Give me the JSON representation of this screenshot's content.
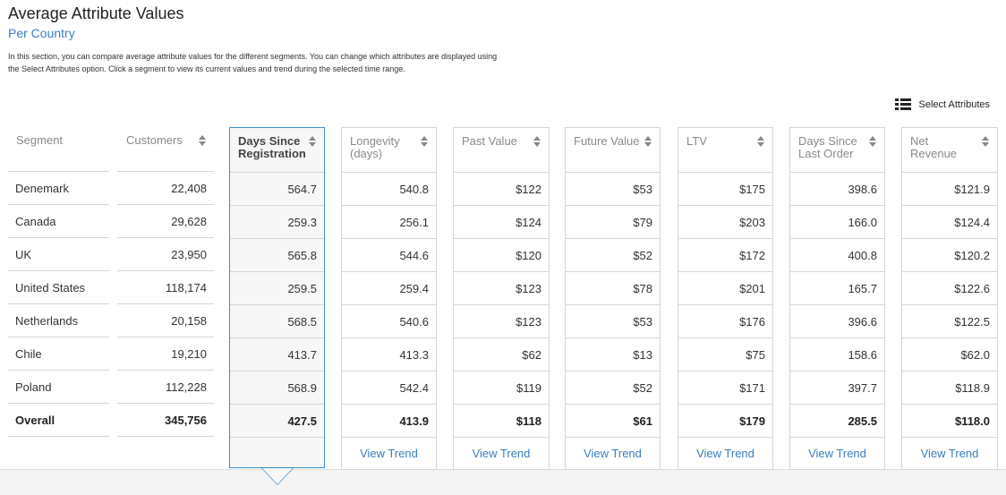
{
  "title": "Average Attribute Values",
  "subtitle": "Per Country",
  "description": "In this section, you can compare average attribute values for the different segments. You can change which attributes are displayed using the Select Attributes option. Click a segment to view its current values and trend during the selected time range.",
  "select_attributes": {
    "label": "Select Attributes",
    "icon": "list-icon"
  },
  "view_trend_label": "View Trend",
  "columns": {
    "segment": {
      "label": "Segment"
    },
    "customers": {
      "label": "Customers"
    },
    "days_since_registration": {
      "label_line1": "Days Since",
      "label_line2": "Registration"
    },
    "longevity": {
      "label_line1": "Longevity",
      "label_line2": "(days)"
    },
    "past_value": {
      "label": "Past Value"
    },
    "future_value": {
      "label": "Future Value"
    },
    "ltv": {
      "label": "LTV"
    },
    "days_since_last_order": {
      "label_line1": "Days Since",
      "label_line2": "Last Order"
    },
    "net_revenue": {
      "label_line1": "Net",
      "label_line2": "Revenue"
    }
  },
  "rows": [
    {
      "segment": "Denemark",
      "customers": "22,408",
      "dsr": "564.7",
      "longevity": "540.8",
      "past": "$122",
      "future": "$53",
      "ltv": "$175",
      "dslo": "398.6",
      "net": "$121.9"
    },
    {
      "segment": "Canada",
      "customers": "29,628",
      "dsr": "259.3",
      "longevity": "256.1",
      "past": "$124",
      "future": "$79",
      "ltv": "$203",
      "dslo": "166.0",
      "net": "$124.4"
    },
    {
      "segment": "UK",
      "customers": "23,950",
      "dsr": "565.8",
      "longevity": "544.6",
      "past": "$120",
      "future": "$52",
      "ltv": "$172",
      "dslo": "400.8",
      "net": "$120.2"
    },
    {
      "segment": "United States",
      "customers": "118,174",
      "dsr": "259.5",
      "longevity": "259.4",
      "past": "$123",
      "future": "$78",
      "ltv": "$201",
      "dslo": "165.7",
      "net": "$122.6"
    },
    {
      "segment": "Netherlands",
      "customers": "20,158",
      "dsr": "568.5",
      "longevity": "540.6",
      "past": "$123",
      "future": "$53",
      "ltv": "$176",
      "dslo": "396.6",
      "net": "$122.5"
    },
    {
      "segment": "Chile",
      "customers": "19,210",
      "dsr": "413.7",
      "longevity": "413.3",
      "past": "$62",
      "future": "$13",
      "ltv": "$75",
      "dslo": "158.6",
      "net": "$62.0"
    },
    {
      "segment": "Poland",
      "customers": "112,228",
      "dsr": "568.9",
      "longevity": "542.4",
      "past": "$119",
      "future": "$52",
      "ltv": "$171",
      "dslo": "397.7",
      "net": "$118.9"
    },
    {
      "segment": "Overall",
      "customers": "345,756",
      "dsr": "427.5",
      "longevity": "413.9",
      "past": "$118",
      "future": "$61",
      "ltv": "$179",
      "dslo": "285.5",
      "net": "$118.0"
    }
  ],
  "colors": {
    "accent": "#3a8fd0",
    "link": "#3a7ec0",
    "border": "#d6d6d6"
  }
}
